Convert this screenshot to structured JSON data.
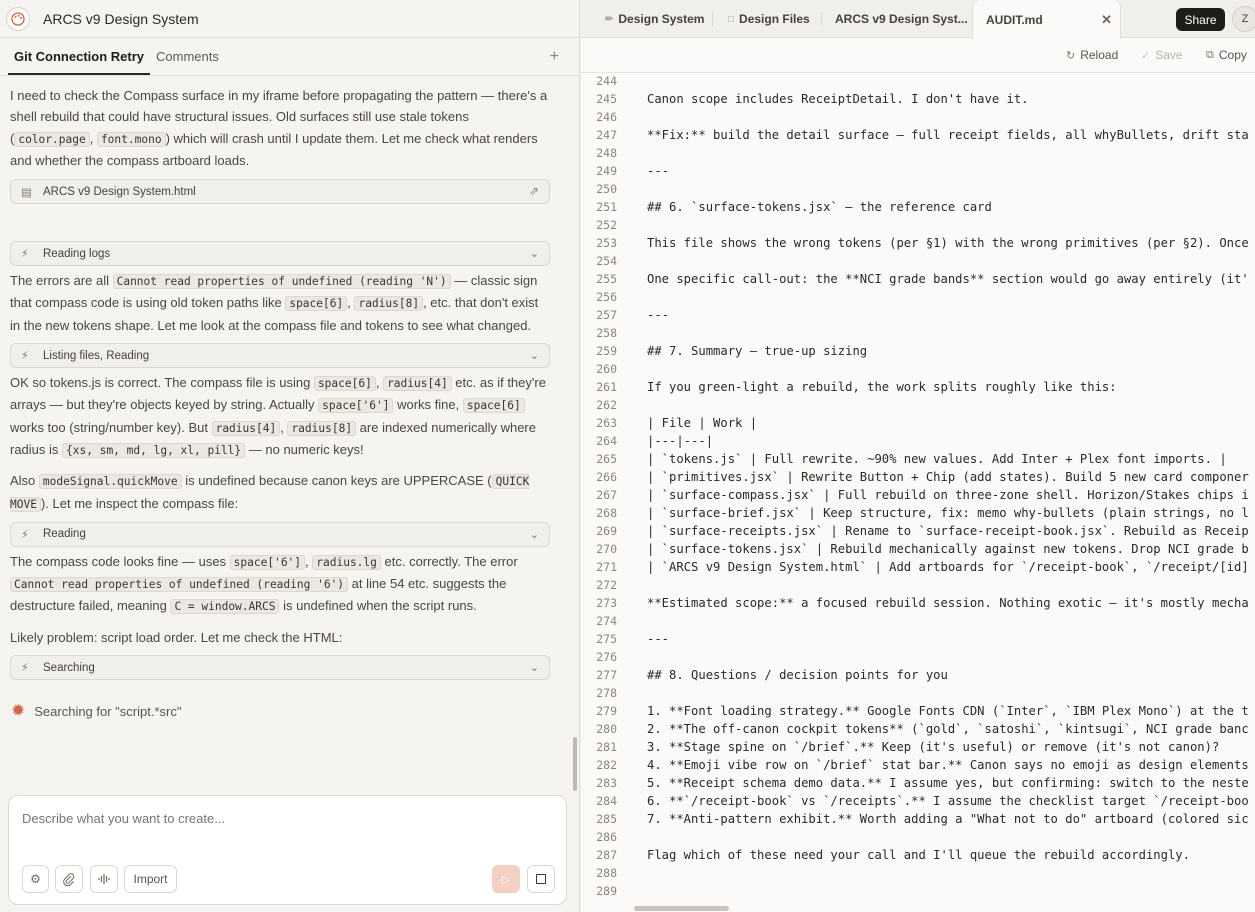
{
  "app": {
    "title": "ARCS v9 Design System"
  },
  "left_tabs": {
    "active": "Git Connection Retry",
    "other": "Comments",
    "add": "+"
  },
  "chat": {
    "intro": [
      {
        "t": "I need to check the Compass surface in my iframe before propagating the pattern — there's a shell rebuild that could have structural issues. Old surfaces still use stale tokens ("
      },
      {
        "c": "color.page"
      },
      {
        "t": ", "
      },
      {
        "c": "font.mono"
      },
      {
        "t": ") which will crash until I update them. Let me check what renders and whether the compass artboard loads."
      }
    ],
    "file_card": "ARCS v9 Design System.html",
    "pill_1": "Reading logs",
    "para_2": [
      {
        "t": "The errors are all "
      },
      {
        "c": "Cannot read properties of undefined (reading 'N')"
      },
      {
        "t": " — classic sign that compass code is using old token paths like "
      },
      {
        "c": "space[6]"
      },
      {
        "t": ", "
      },
      {
        "c": "radius[8]"
      },
      {
        "t": ", etc. that don't exist in the new tokens shape. Let me look at the compass file and tokens to see what changed."
      }
    ],
    "pill_2": "Listing files, Reading",
    "para_3": [
      {
        "t": "OK so tokens.js is correct. The compass file is using "
      },
      {
        "c": "space[6]"
      },
      {
        "t": ", "
      },
      {
        "c": "radius[4]"
      },
      {
        "t": " etc. as if they're arrays — but they're objects keyed by string. Actually "
      },
      {
        "c": "space['6']"
      },
      {
        "t": " works fine, "
      },
      {
        "c": "space[6]"
      },
      {
        "t": " works too (string/number key). But "
      },
      {
        "c": "radius[4]"
      },
      {
        "t": ", "
      },
      {
        "c": "radius[8]"
      },
      {
        "t": " are indexed numerically where radius is "
      },
      {
        "c": "{xs, sm, md, lg, xl, pill}"
      },
      {
        "t": " — no numeric keys!"
      }
    ],
    "para_4": [
      {
        "t": "Also "
      },
      {
        "c": "modeSignal.quickMove"
      },
      {
        "t": " is undefined because canon keys are UPPERCASE ("
      },
      {
        "c": "QUICK MOVE"
      },
      {
        "t": "). Let me inspect the compass file:"
      }
    ],
    "pill_3": "Reading",
    "para_5": [
      {
        "t": "The compass code looks fine — uses "
      },
      {
        "c": "space['6']"
      },
      {
        "t": ", "
      },
      {
        "c": "radius.lg"
      },
      {
        "t": " etc. correctly. The error "
      },
      {
        "c": "Cannot read properties of undefined (reading '6')"
      },
      {
        "t": " at line 54 etc. suggests the destructure failed, meaning "
      },
      {
        "c": "C = window.ARCS"
      },
      {
        "t": " is undefined when the script runs."
      }
    ],
    "para_6": [
      {
        "t": "Likely problem: script load order. Let me check the HTML:"
      }
    ],
    "pill_4": "Searching",
    "status": "Searching for \"script.*src\""
  },
  "composer": {
    "placeholder": "Describe what you want to create...",
    "import_label": "Import"
  },
  "tabs": [
    {
      "label": "Design System",
      "icon": "pen-icon"
    },
    {
      "label": "Design Files",
      "icon": "folder-icon"
    },
    {
      "label": "ARCS v9 Design Syst...",
      "icon": ""
    },
    {
      "label": "AUDIT.md",
      "icon": ""
    }
  ],
  "share_label": "Share",
  "avatar_initial": "Z",
  "toolbar": {
    "reload": "Reload",
    "save": "Save",
    "copy": "Copy"
  },
  "editor": {
    "lines": [
      {
        "n": "244",
        "t": ""
      },
      {
        "n": "245",
        "t": "Canon scope includes ReceiptDetail. I don't have it."
      },
      {
        "n": "246",
        "t": ""
      },
      {
        "n": "247",
        "t": "**Fix:** build the detail surface — full receipt fields, all whyBullets, drift sta"
      },
      {
        "n": "248",
        "t": ""
      },
      {
        "n": "249",
        "t": "---"
      },
      {
        "n": "250",
        "t": ""
      },
      {
        "n": "251",
        "t": "## 6. `surface-tokens.jsx` — the reference card"
      },
      {
        "n": "252",
        "t": ""
      },
      {
        "n": "253",
        "t": "This file shows the wrong tokens (per §1) with the wrong primitives (per §2). Once"
      },
      {
        "n": "254",
        "t": ""
      },
      {
        "n": "255",
        "t": "One specific call-out: the **NCI grade bands** section would go away entirely (it'"
      },
      {
        "n": "256",
        "t": ""
      },
      {
        "n": "257",
        "t": "---"
      },
      {
        "n": "258",
        "t": ""
      },
      {
        "n": "259",
        "t": "## 7. Summary — true-up sizing"
      },
      {
        "n": "260",
        "t": ""
      },
      {
        "n": "261",
        "t": "If you green-light a rebuild, the work splits roughly like this:"
      },
      {
        "n": "262",
        "t": ""
      },
      {
        "n": "263",
        "t": "| File | Work |"
      },
      {
        "n": "264",
        "t": "|---|---|"
      },
      {
        "n": "265",
        "t": "| `tokens.js` | Full rewrite. ~90% new values. Add Inter + Plex font imports. |"
      },
      {
        "n": "266",
        "t": "| `primitives.jsx` | Rewrite Button + Chip (add states). Build 5 new card componer"
      },
      {
        "n": "267",
        "t": "| `surface-compass.jsx` | Full rebuild on three-zone shell. Horizon/Stakes chips i"
      },
      {
        "n": "268",
        "t": "| `surface-brief.jsx` | Keep structure, fix: memo why-bullets (plain strings, no l"
      },
      {
        "n": "269",
        "t": "| `surface-receipts.jsx` | Rename to `surface-receipt-book.jsx`. Rebuild as Receip"
      },
      {
        "n": "270",
        "t": "| `surface-tokens.jsx` | Rebuild mechanically against new tokens. Drop NCI grade b"
      },
      {
        "n": "271",
        "t": "| `ARCS v9 Design System.html` | Add artboards for `/receipt-book`, `/receipt/[id]"
      },
      {
        "n": "272",
        "t": ""
      },
      {
        "n": "273",
        "t": "**Estimated scope:** a focused rebuild session. Nothing exotic — it's mostly mecha"
      },
      {
        "n": "274",
        "t": ""
      },
      {
        "n": "275",
        "t": "---"
      },
      {
        "n": "276",
        "t": ""
      },
      {
        "n": "277",
        "t": "## 8. Questions / decision points for you"
      },
      {
        "n": "278",
        "t": ""
      },
      {
        "n": "279",
        "t": "1. **Font loading strategy.** Google Fonts CDN (`Inter`, `IBM Plex Mono`) at the t"
      },
      {
        "n": "280",
        "t": "2. **The off-canon cockpit tokens** (`gold`, `satoshi`, `kintsugi`, NCI grade banc"
      },
      {
        "n": "281",
        "t": "3. **Stage spine on `/brief`.** Keep (it's useful) or remove (it's not canon)?"
      },
      {
        "n": "282",
        "t": "4. **Emoji vibe row on `/brief` stat bar.** Canon says no emoji as design elements"
      },
      {
        "n": "283",
        "t": "5. **Receipt schema demo data.** I assume yes, but confirming: switch to the neste"
      },
      {
        "n": "284",
        "t": "6. **`/receipt-book` vs `/receipts`.** I assume the checklist target `/receipt-boo"
      },
      {
        "n": "285",
        "t": "7. **Anti-pattern exhibit.** Worth adding a \"What not to do\" artboard (colored sic"
      },
      {
        "n": "286",
        "t": ""
      },
      {
        "n": "287",
        "t": "Flag which of these need your call and I'll queue the rebuild accordingly."
      },
      {
        "n": "288",
        "t": ""
      },
      {
        "n": "289",
        "t": ""
      }
    ]
  },
  "colors": {
    "accent": "#d1664a",
    "dark_button": "#1f1d1a",
    "send_disabled": "#f4d0c3"
  }
}
